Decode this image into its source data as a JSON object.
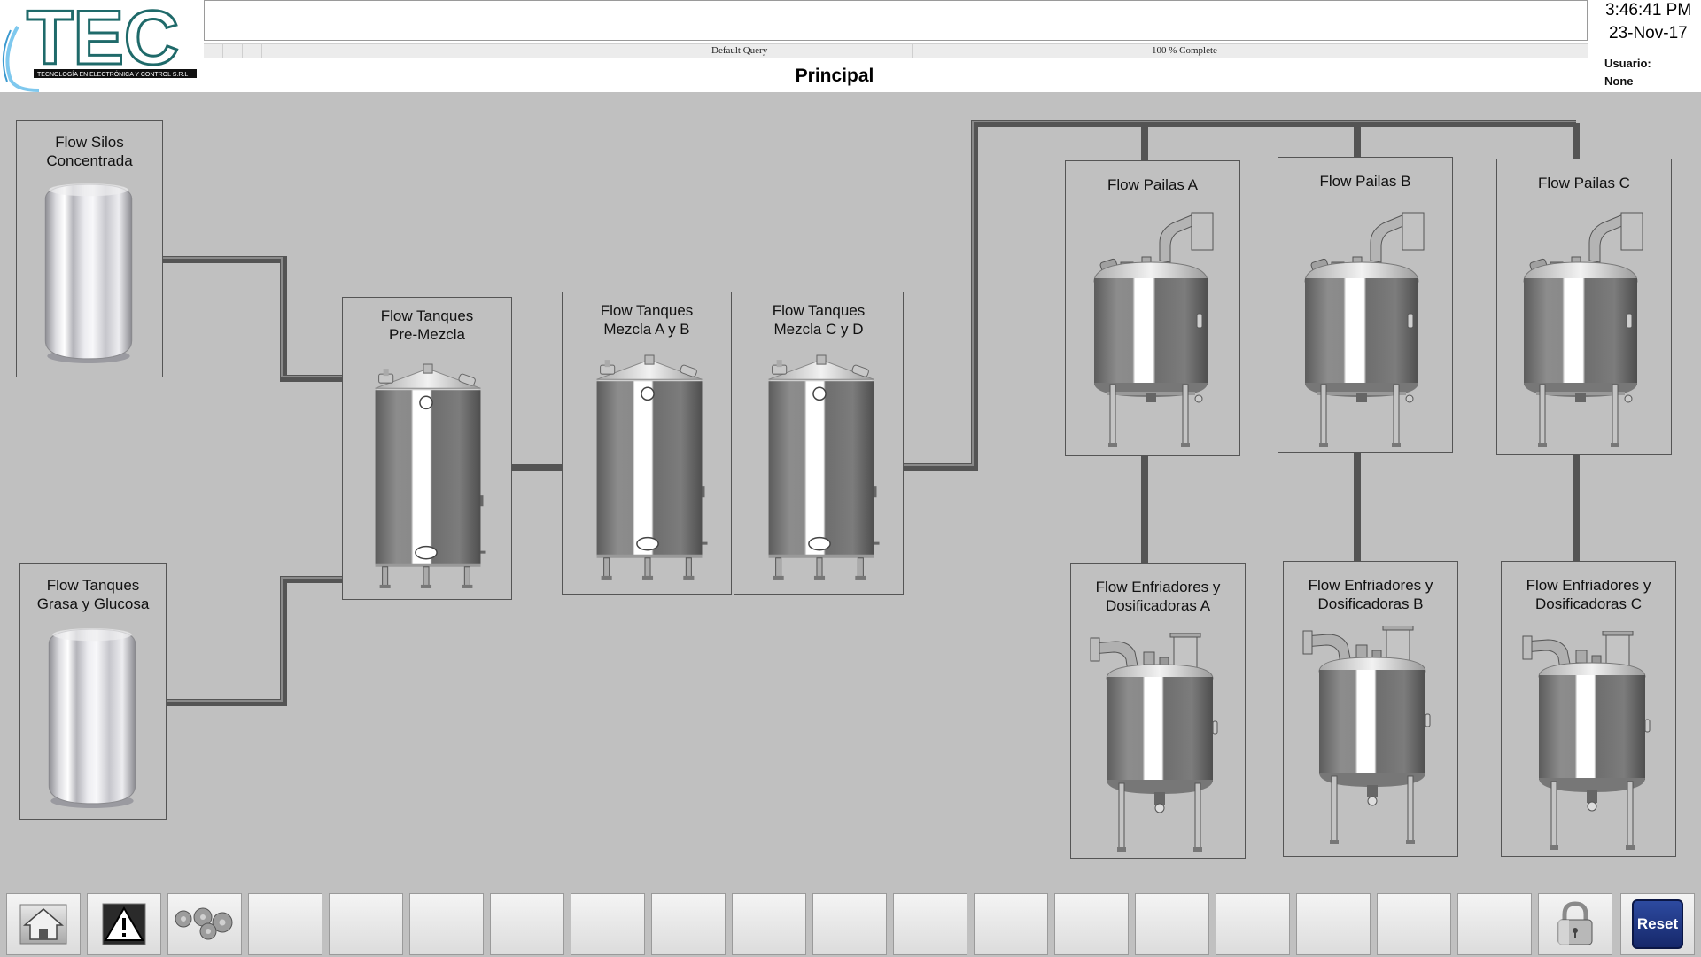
{
  "header": {
    "logo_text": "TEC",
    "logo_subtitle": "TECNOLOGÍA EN ELECTRÓNICA Y CONTROL S.R.L",
    "query_label": "Default Query",
    "progress_label": "100 % Complete",
    "page_title": "Principal",
    "time": "3:46:41 PM",
    "date": "23-Nov-17",
    "user_label": "Usuario:",
    "user_value": "None"
  },
  "panels": {
    "silos": {
      "line1": "Flow Silos",
      "line2": "Concentrada"
    },
    "grasa": {
      "line1": "Flow Tanques",
      "line2": "Grasa y Glucosa"
    },
    "premezcla": {
      "line1": "Flow Tanques",
      "line2": "Pre-Mezcla"
    },
    "mezcla_ab": {
      "line1": "Flow Tanques",
      "line2": "Mezcla A y B"
    },
    "mezcla_cd": {
      "line1": "Flow Tanques",
      "line2": "Mezcla C y D"
    },
    "pailas_a": {
      "line1": "Flow Pailas A"
    },
    "pailas_b": {
      "line1": "Flow Pailas B"
    },
    "pailas_c": {
      "line1": "Flow Pailas C"
    },
    "enfriadores_a": {
      "line1": "Flow Enfriadores y",
      "line2": "Dosificadoras A"
    },
    "enfriadores_b": {
      "line1": "Flow Enfriadores y",
      "line2": "Dosificadoras B"
    },
    "enfriadores_c": {
      "line1": "Flow Enfriadores y",
      "line2": "Dosificadoras C"
    }
  },
  "toolbar": {
    "home_icon": "home-icon",
    "alarm_icon": "warning-icon",
    "settings_icon": "gears-icon",
    "lock_icon": "padlock-icon",
    "reset_label": "Reset"
  },
  "colors": {
    "background": "#c0c0c0",
    "pipe": "#545454",
    "logo_teal": "#1f6a6a",
    "reset_blue": "#1e3585"
  }
}
